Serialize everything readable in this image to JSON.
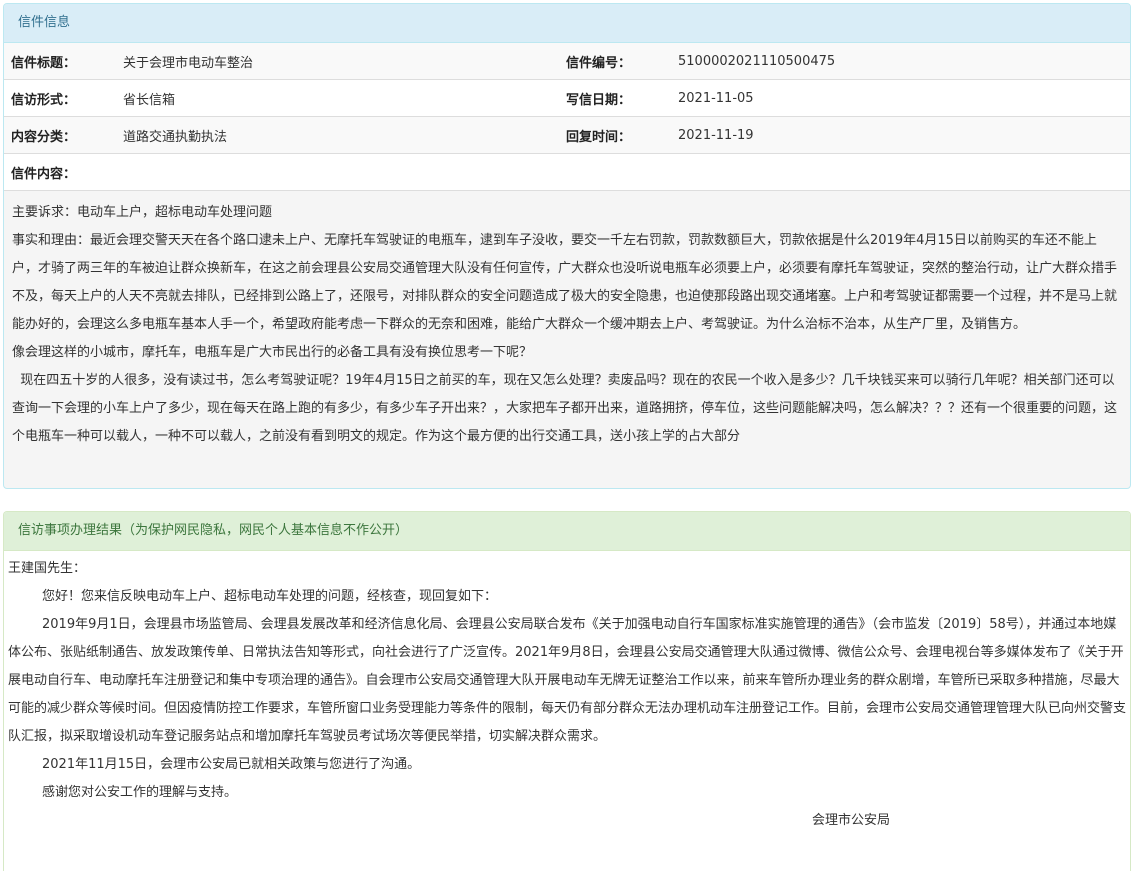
{
  "letter_panel": {
    "title": "信件信息",
    "rows": [
      {
        "label1": "信件标题：",
        "value1": "关于会理市电动车整治",
        "label2": "信件编号：",
        "value2": "5100002021110500475"
      },
      {
        "label1": "信访形式：",
        "value1": "省长信箱",
        "label2": "写信日期：",
        "value2": "2021-11-05"
      },
      {
        "label1": "内容分类：",
        "value1": "道路交通执勤执法",
        "label2": "回复时间：",
        "value2": "2021-11-19"
      }
    ],
    "content_label": "信件内容：",
    "content_paragraphs": [
      "主要诉求：电动车上户，超标电动车处理问题",
      "事实和理由：最近会理交警天天在各个路口逮未上户、无摩托车驾驶证的电瓶车，逮到车子没收，要交一千左右罚款，罚款数额巨大，罚款依据是什么2019年4月15日以前购买的车还不能上户，才骑了两三年的车被迫让群众换新车，在这之前会理县公安局交通管理大队没有任何宣传，广大群众也没听说电瓶车必须要上户，必须要有摩托车驾驶证，突然的整治行动，让广大群众措手不及，每天上户的人天不亮就去排队，已经排到公路上了，还限号，对排队群众的安全问题造成了极大的安全隐患，也迫使那段路出现交通堵塞。上户和考驾驶证都需要一个过程，并不是马上就能办好的，会理这么多电瓶车基本人手一个，希望政府能考虑一下群众的无奈和困难，能给广大群众一个缓冲期去上户、考驾驶证。为什么治标不治本，从生产厂里，及销售方。",
      "像会理这样的小城市，摩托车，电瓶车是广大市民出行的必备工具有没有换位思考一下呢？",
      "  现在四五十岁的人很多，没有读过书，怎么考驾驶证呢？19年4月15日之前买的车，现在又怎么处理？卖废品吗？现在的农民一个收入是多少？几千块钱买来可以骑行几年呢？相关部门还可以查询一下会理的小车上户了多少，现在每天在路上跑的有多少，有多少车子开出来？，大家把车子都开出来，道路拥挤，停车位，这些问题能解决吗，怎么解决？？？还有一个很重要的问题，这个电瓶车一种可以载人，一种不可以载人，之前没有看到明文的规定。作为这个最方便的出行交通工具，送小孩上学的占大部分"
    ]
  },
  "result_panel": {
    "title": "信访事项办理结果（为保护网民隐私，网民个人基本信息不作公开）",
    "salutation": "王建国先生：",
    "paragraphs": [
      "您好！您来信反映电动车上户、超标电动车处理的问题，经核查，现回复如下：",
      "2019年9月1日，会理县市场监管局、会理县发展改革和经济信息化局、会理县公安局联合发布《关于加强电动自行车国家标准实施管理的通告》（会市监发〔2019〕58号），并通过本地媒体公布、张贴纸制通告、放发政策传单、日常执法告知等形式，向社会进行了广泛宣传。2021年9月8日，会理县公安局交通管理大队通过微博、微信公众号、会理电视台等多媒体发布了《关于开展电动自行车、电动摩托车注册登记和集中专项治理的通告》。自会理市公安局交通管理大队开展电动车无牌无证整治工作以来，前来车管所办理业务的群众剧增，车管所已采取多种措施，尽最大可能的减少群众等候时间。但因疫情防控工作要求，车管所窗口业务受理能力等条件的限制，每天仍有部分群众无法办理机动车注册登记工作。目前，会理市公安局交通管理管理大队已向州交警支队汇报，拟采取增设机动车登记服务站点和增加摩托车驾驶员考试场次等便民举措，切实解决群众需求。",
      "2021年11月15日，会理市公安局已就相关政策与您进行了沟通。",
      "感谢您对公安工作的理解与支持。"
    ],
    "signature": "会理市公安局"
  }
}
